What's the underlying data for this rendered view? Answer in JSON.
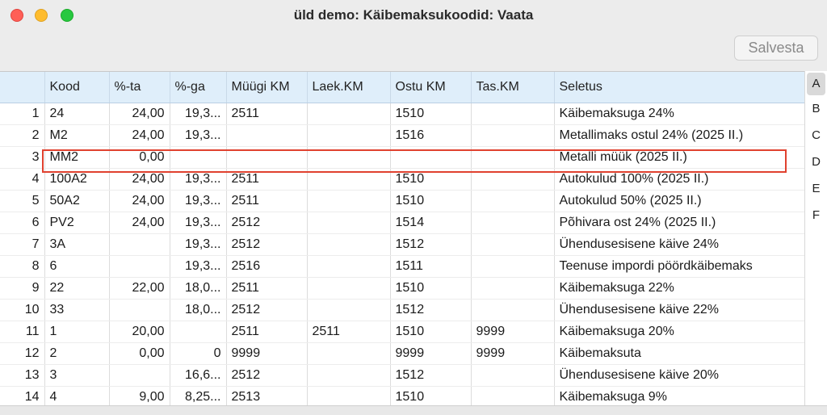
{
  "window": {
    "title": "üld demo: Käibemaksukoodid: Vaata"
  },
  "toolbar": {
    "save_label": "Salvesta"
  },
  "table": {
    "columns": [
      "",
      "Kood",
      "%-ta",
      "%-ga",
      "Müügi KM",
      "Laek.KM",
      "Ostu KM",
      "Tas.KM",
      "Seletus"
    ],
    "rows": [
      [
        "1",
        "24",
        "24,00",
        "19,3...",
        "2511",
        "",
        "1510",
        "",
        "Käibemaksuga 24%"
      ],
      [
        "2",
        "M2",
        "24,00",
        "19,3...",
        "",
        "",
        "1516",
        "",
        "Metallimaks ostul 24% (2025 II.)"
      ],
      [
        "3",
        "MM2",
        "0,00",
        "",
        "",
        "",
        "",
        "",
        "Metalli müük (2025 II.)"
      ],
      [
        "4",
        "100A2",
        "24,00",
        "19,3...",
        "2511",
        "",
        "1510",
        "",
        "Autokulud 100% (2025 II.)"
      ],
      [
        "5",
        "50A2",
        "24,00",
        "19,3...",
        "2511",
        "",
        "1510",
        "",
        "Autokulud 50% (2025 II.)"
      ],
      [
        "6",
        "PV2",
        "24,00",
        "19,3...",
        "2512",
        "",
        "1514",
        "",
        "Põhivara ost 24% (2025 II.)"
      ],
      [
        "7",
        "3A",
        "",
        "19,3...",
        "2512",
        "",
        "1512",
        "",
        "Ühendusesisene käive 24%"
      ],
      [
        "8",
        "6",
        "",
        "19,3...",
        "2516",
        "",
        "1511",
        "",
        "Teenuse impordi pöördkäibemaks"
      ],
      [
        "9",
        "22",
        "22,00",
        "18,0...",
        "2511",
        "",
        "1510",
        "",
        "Käibemaksuga 22%"
      ],
      [
        "10",
        "33",
        "",
        "18,0...",
        "2512",
        "",
        "1512",
        "",
        "Ühendusesisene käive 22%"
      ],
      [
        "11",
        "1",
        "20,00",
        "",
        "2511",
        "2511",
        "1510",
        "9999",
        "Käibemaksuga 20%"
      ],
      [
        "12",
        "2",
        "0,00",
        "0",
        "9999",
        "",
        "9999",
        "9999",
        "Käibemaksuta"
      ],
      [
        "13",
        "3",
        "",
        "16,6...",
        "2512",
        "",
        "1512",
        "",
        "Ühendusesisene käive 20%"
      ],
      [
        "14",
        "4",
        "9,00",
        "8,25...",
        "2513",
        "",
        "1510",
        "",
        "Käibemaksuga 9%"
      ]
    ]
  },
  "az_index": [
    "A",
    "B",
    "C",
    "D",
    "E",
    "F"
  ],
  "colors": {
    "header_bg": "#dfeefa",
    "highlight": "#e0412f"
  }
}
